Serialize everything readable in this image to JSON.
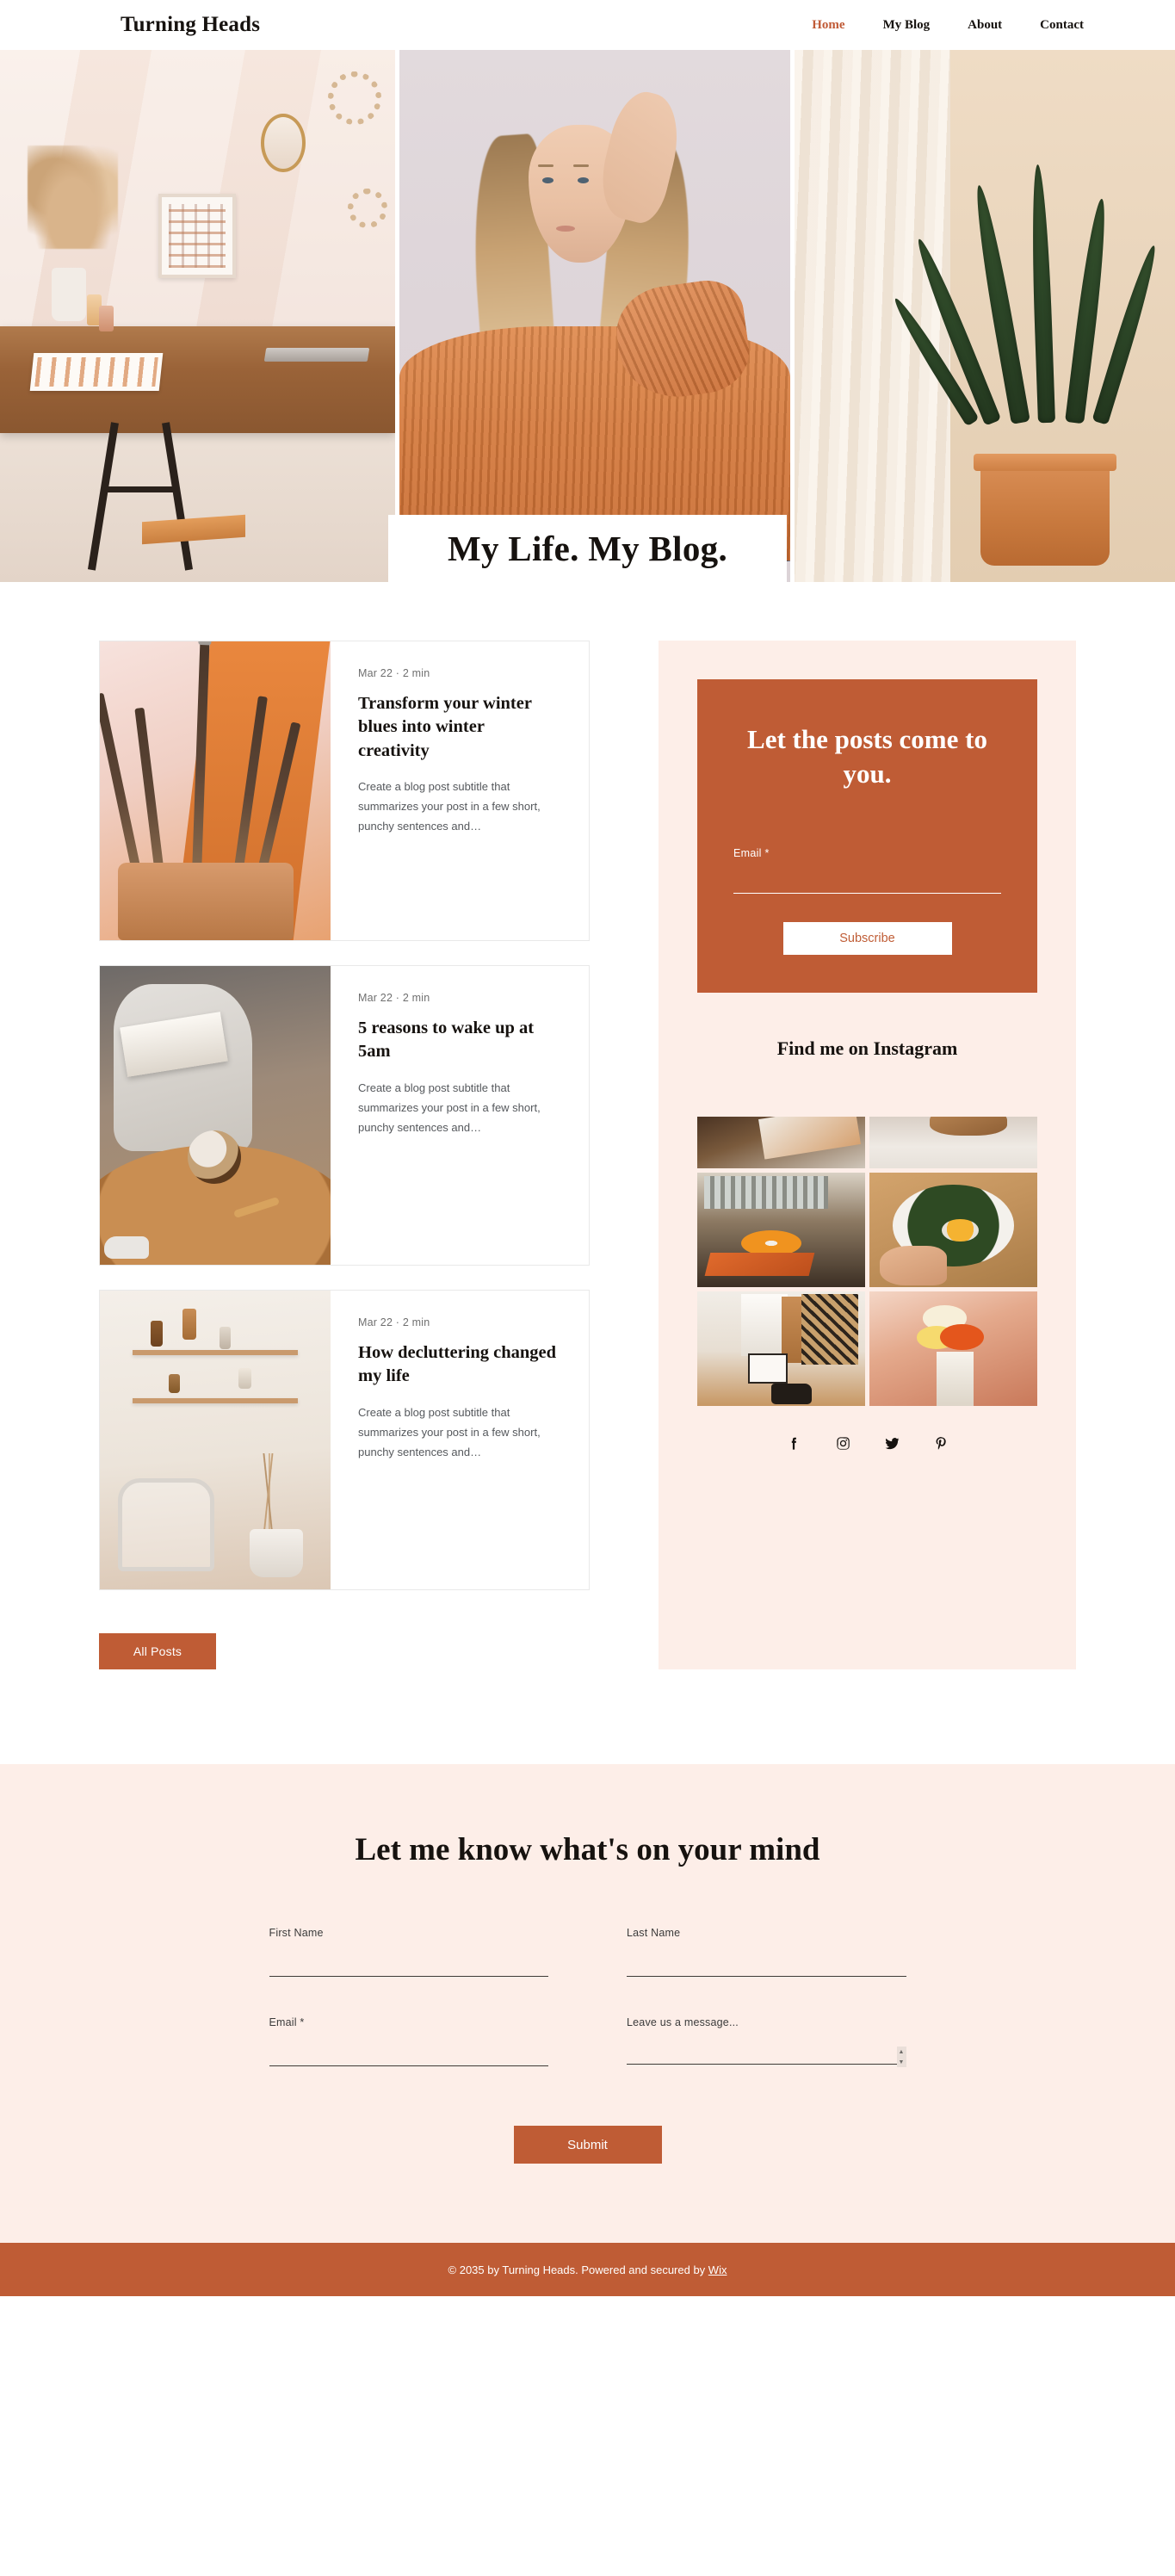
{
  "header": {
    "brand": "Turning Heads",
    "nav": [
      {
        "label": "Home",
        "active": true
      },
      {
        "label": "My Blog",
        "active": false
      },
      {
        "label": "About",
        "active": false
      },
      {
        "label": "Contact",
        "active": false
      }
    ]
  },
  "hero": {
    "title": "My Life. My Blog.",
    "images": [
      {
        "alt": "pink-home-office-desk"
      },
      {
        "alt": "woman-in-orange-sweater-portrait"
      },
      {
        "alt": "snake-plant-in-terracotta-pot"
      }
    ]
  },
  "blog": {
    "posts": [
      {
        "date": "Mar 22",
        "separator": "·",
        "read_time": "2 min",
        "title": "Transform your winter blues into winter creativity",
        "excerpt": "Create a blog post subtitle that summarizes your post in a few short, punchy sentences and…",
        "thumb_alt": "paint-brushes-in-copper-cup"
      },
      {
        "date": "Mar 22",
        "separator": "·",
        "read_time": "2 min",
        "title": "5 reasons to wake up at 5am",
        "excerpt": "Create a blog post subtitle that summarizes your post in a few short, punchy sentences and…",
        "thumb_alt": "woman-reading-book-with-coffee"
      },
      {
        "date": "Mar 22",
        "separator": "·",
        "read_time": "2 min",
        "title": "How decluttering changed my life",
        "excerpt": "Create a blog post subtitle that summarizes your post in a few short, punchy sentences and…",
        "thumb_alt": "minimal-shelf-and-chair-interior"
      }
    ],
    "all_posts_label": "All Posts"
  },
  "sidebar": {
    "subscribe": {
      "title": "Let the posts come to you.",
      "email_label": "Email *",
      "email_value": "",
      "email_placeholder": "",
      "button_label": "Subscribe"
    },
    "instagram": {
      "title": "Find me on Instagram",
      "tiles": [
        {
          "alt": "magazine-on-wooden-table"
        },
        {
          "alt": "dog-on-white-bedsheets"
        },
        {
          "alt": "record-player-by-the-window"
        },
        {
          "alt": "kale-bowl-with-egg"
        },
        {
          "alt": "clothes-rack-and-boots"
        },
        {
          "alt": "girl-with-balloons"
        }
      ]
    },
    "social": [
      {
        "name": "facebook-icon"
      },
      {
        "name": "instagram-icon"
      },
      {
        "name": "twitter-icon"
      },
      {
        "name": "pinterest-icon"
      }
    ]
  },
  "contact": {
    "title": "Let me know what's on your mind",
    "fields": {
      "first_name": {
        "label": "First Name",
        "value": ""
      },
      "last_name": {
        "label": "Last Name",
        "value": ""
      },
      "email": {
        "label": "Email *",
        "value": ""
      },
      "message": {
        "label": "Leave us a message...",
        "value": ""
      }
    },
    "submit_label": "Submit"
  },
  "footer": {
    "text": "© 2035 by Turning Heads. Powered and secured by ",
    "link": "Wix"
  },
  "colors": {
    "accent": "#bf5c35",
    "accent_text": "#c05a36",
    "blush_bg": "#fdeee8",
    "dark_text": "#16120f"
  }
}
